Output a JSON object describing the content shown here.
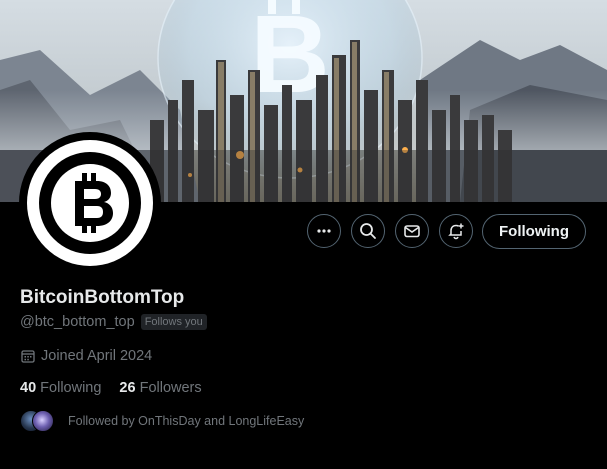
{
  "profile": {
    "display_name": "BitcoinBottomTop",
    "handle": "@btc_bottom_top",
    "follows_you_badge": "Follows you",
    "joined": "Joined April 2024",
    "following_count": "40",
    "following_label": "Following",
    "followers_count": "26",
    "followers_label": "Followers",
    "followed_by_text": "Followed by OnThisDay and LongLifeEasy"
  },
  "actions": {
    "more_icon": "more-horizontal-icon",
    "search_icon": "search-icon",
    "message_icon": "envelope-icon",
    "notify_icon": "bell-plus-icon",
    "following_button_label": "Following"
  },
  "colors": {
    "background": "#000000",
    "text_primary": "#e7e9ea",
    "text_secondary": "#71767b",
    "button_border": "#536471"
  }
}
